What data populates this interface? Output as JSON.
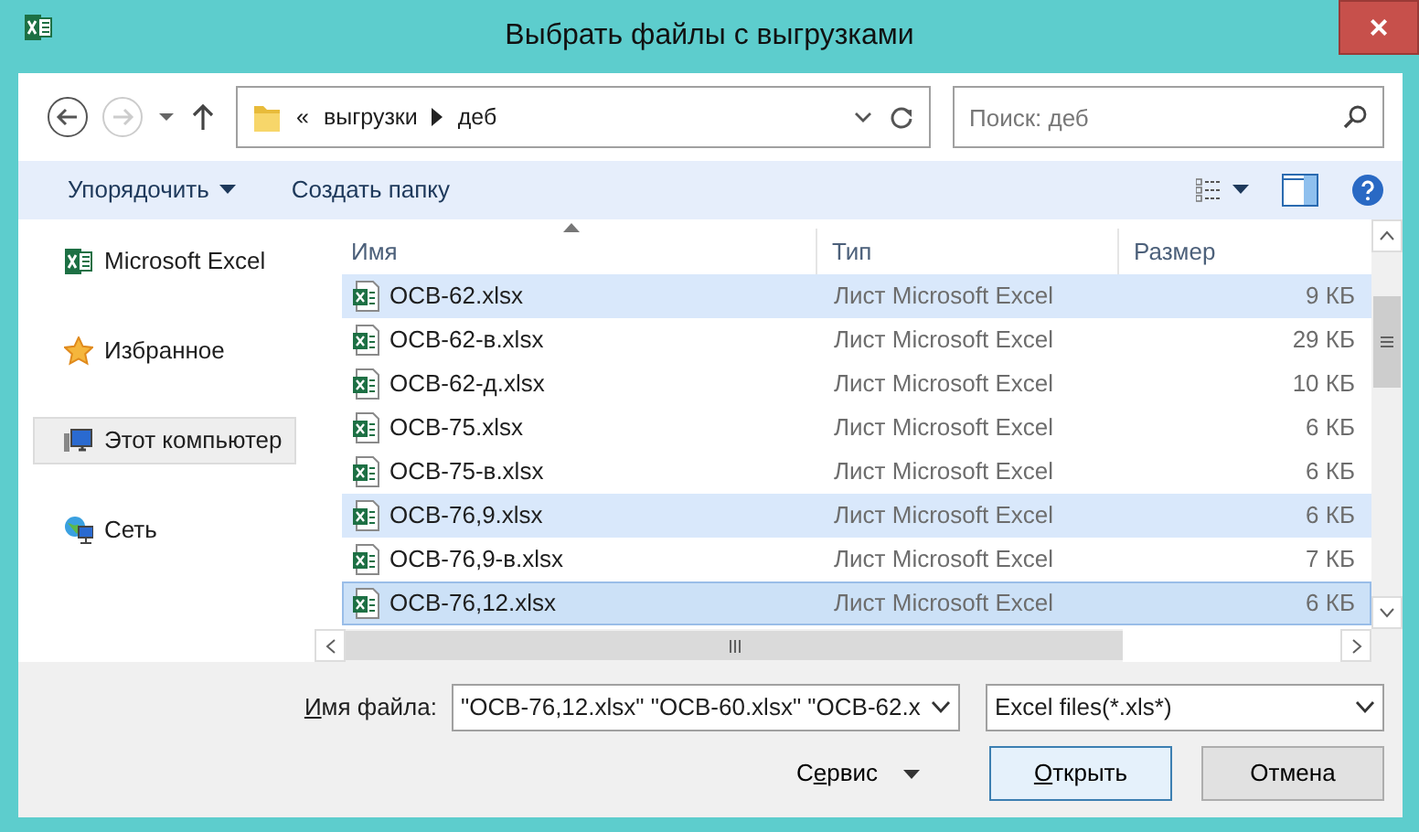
{
  "window": {
    "title": "Выбрать файлы с выгрузками",
    "close": "×"
  },
  "navigation": {
    "path": [
      "выгрузки",
      "деб"
    ],
    "path_prefix": "«",
    "search": {
      "placeholder": "Поиск: деб"
    }
  },
  "toolbar": {
    "organize": "Упорядочить",
    "new_folder": "Создать папку"
  },
  "sidebar": {
    "items": [
      {
        "label": "Microsoft Excel",
        "kind": "excel",
        "selected": false
      },
      {
        "label": "Избранное",
        "kind": "star",
        "selected": false
      },
      {
        "label": "Этот компьютер",
        "kind": "computer",
        "selected": true
      },
      {
        "label": "Сеть",
        "kind": "network",
        "selected": false
      }
    ]
  },
  "table": {
    "columns": [
      "Имя",
      "Тип",
      "Размер"
    ],
    "rows": [
      {
        "name": "ОСВ-62.xlsx",
        "type": "Лист Microsoft Excel",
        "size": "9 КБ",
        "selected": true,
        "focused": false
      },
      {
        "name": "ОСВ-62-в.xlsx",
        "type": "Лист Microsoft Excel",
        "size": "29 КБ",
        "selected": false,
        "focused": false
      },
      {
        "name": "ОСВ-62-д.xlsx",
        "type": "Лист Microsoft Excel",
        "size": "10 КБ",
        "selected": false,
        "focused": false
      },
      {
        "name": "ОСВ-75.xlsx",
        "type": "Лист Microsoft Excel",
        "size": "6 КБ",
        "selected": false,
        "focused": false
      },
      {
        "name": "ОСВ-75-в.xlsx",
        "type": "Лист Microsoft Excel",
        "size": "6 КБ",
        "selected": false,
        "focused": false
      },
      {
        "name": "ОСВ-76,9.xlsx",
        "type": "Лист Microsoft Excel",
        "size": "6 КБ",
        "selected": true,
        "focused": false
      },
      {
        "name": "ОСВ-76,9-в.xlsx",
        "type": "Лист Microsoft Excel",
        "size": "7 КБ",
        "selected": false,
        "focused": false
      },
      {
        "name": "ОСВ-76,12.xlsx",
        "type": "Лист Microsoft Excel",
        "size": "6 КБ",
        "selected": true,
        "focused": true
      }
    ]
  },
  "footer": {
    "filename_label": {
      "key": "И",
      "after": "мя файла:"
    },
    "filename_value": "\"ОСВ-76,12.xlsx\" \"ОСВ-60.xlsx\" \"ОСВ-62.x",
    "filetype": "Excel files(*.xls*)",
    "tools": {
      "before": "С",
      "key": "е",
      "after": "рвис"
    },
    "open": {
      "key": "О",
      "after": "ткрыть"
    },
    "cancel": "Отмена"
  }
}
